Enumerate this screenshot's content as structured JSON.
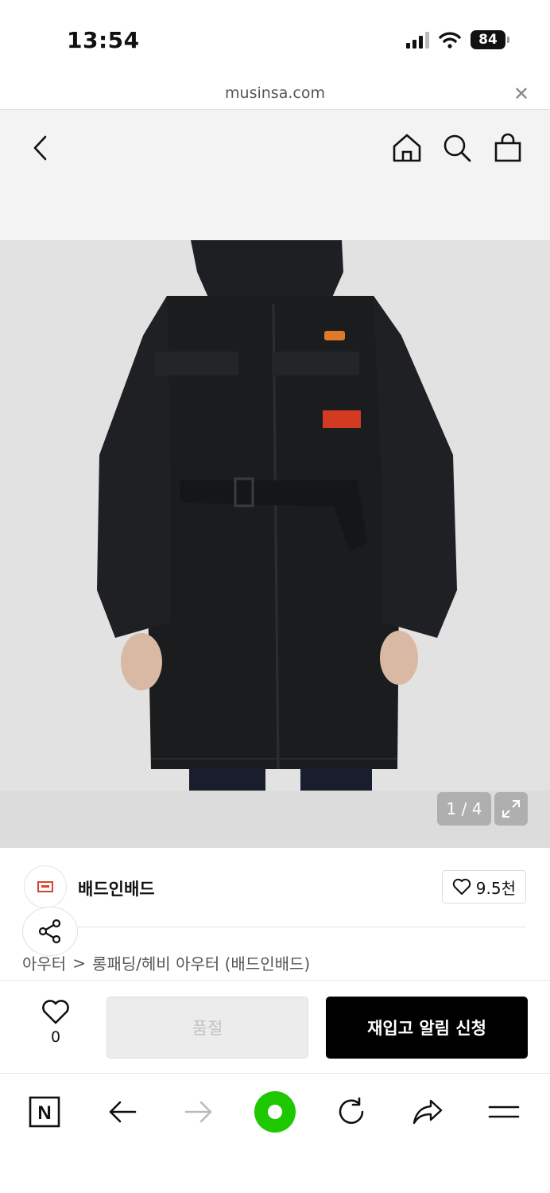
{
  "status_bar": {
    "time": "13:54",
    "battery": "84",
    "icons": [
      "signal-icon",
      "wifi-icon",
      "battery-icon"
    ]
  },
  "url_bar": {
    "domain": "musinsa.com",
    "close_icon": "close-icon"
  },
  "header": {
    "icons": [
      "back-chevron-icon",
      "home-icon",
      "search-icon",
      "shopping-bag-icon"
    ]
  },
  "gallery": {
    "counter": "1 / 4",
    "expand_icon": "expand-icon"
  },
  "brand": {
    "name": "배드인배드",
    "like_count": "9.5천"
  },
  "breadcrumb": {
    "items": [
      "아우터",
      "롱패딩/헤비 아우터 (배드인배드)"
    ],
    "separator": ">"
  },
  "action_bar": {
    "wish_count": "0",
    "soldout_label": "품절",
    "restock_label": "재입고 알림 신청"
  },
  "browser_toolbar": {
    "icons": [
      "naver-n-icon",
      "back-arrow-icon",
      "forward-arrow-icon",
      "green-dot-icon",
      "refresh-icon",
      "share-arrow-icon",
      "menu-icon"
    ],
    "naver_letter": "N"
  },
  "colors": {
    "header_bg": "#f3f3f3",
    "primary_button": "#000000",
    "disabled_button": "#ececec",
    "accent_green": "#1ec800",
    "coat": "#1b1c1e"
  }
}
